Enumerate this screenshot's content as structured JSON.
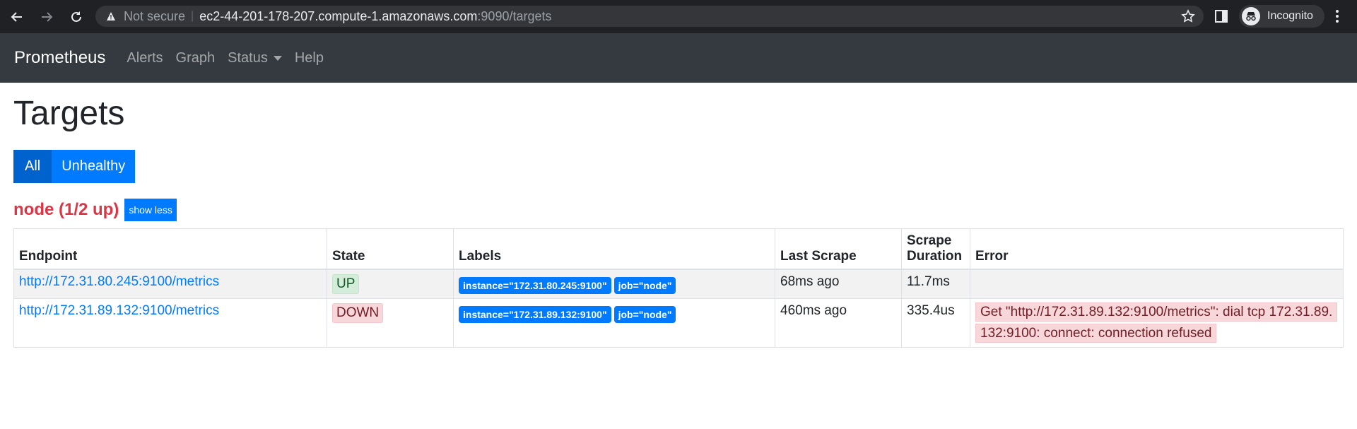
{
  "browser": {
    "not_secure_label": "Not secure",
    "url_host": "ec2-44-201-178-207.compute-1.amazonaws.com",
    "url_path": ":9090/targets",
    "profile_label": "Incognito"
  },
  "navbar": {
    "brand": "Prometheus",
    "links": [
      "Alerts",
      "Graph",
      "Status",
      "Help"
    ]
  },
  "page": {
    "title": "Targets",
    "filters": [
      "All",
      "Unhealthy"
    ],
    "active_filter": "All"
  },
  "job": {
    "title": "node (1/2 up)",
    "toggle_label": "show less",
    "columns": [
      "Endpoint",
      "State",
      "Labels",
      "Last Scrape",
      "Scrape Duration",
      "Error"
    ],
    "rows": [
      {
        "endpoint": "http://172.31.80.245:9100/metrics",
        "state": "UP",
        "labels": [
          "instance=\"172.31.80.245:9100\"",
          "job=\"node\""
        ],
        "last_scrape": "68ms ago",
        "duration": "11.7ms",
        "error": ""
      },
      {
        "endpoint": "http://172.31.89.132:9100/metrics",
        "state": "DOWN",
        "labels": [
          "instance=\"172.31.89.132:9100\"",
          "job=\"node\""
        ],
        "last_scrape": "460ms ago",
        "duration": "335.4us",
        "error": "Get \"http://172.31.89.132:9100/metrics\": dial tcp 172.31.89.132:9100: connect: connection refused"
      }
    ]
  },
  "colors": {
    "navbar_bg": "#343a40",
    "primary": "#007bff",
    "danger": "#dc3545",
    "up_bg": "#d4edda",
    "down_bg": "#f8d7da"
  }
}
